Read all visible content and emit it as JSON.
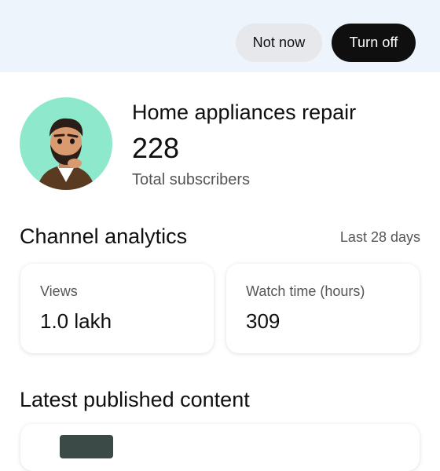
{
  "banner": {
    "not_now_label": "Not now",
    "turn_off_label": "Turn off"
  },
  "channel": {
    "name": "Home appliances repair",
    "subscriber_count": "228",
    "subscriber_label": "Total subscribers"
  },
  "analytics": {
    "title": "Channel analytics",
    "period": "Last 28 days",
    "cards": [
      {
        "label": "Views",
        "value": "1.0 lakh"
      },
      {
        "label": "Watch time (hours)",
        "value": "309"
      }
    ]
  },
  "latest": {
    "title": "Latest published content"
  },
  "colors": {
    "banner_bg": "#eef4fc",
    "primary_button": "#0f0f0f",
    "secondary_button": "#e6e8ec",
    "avatar_bg": "#8ee8cb"
  }
}
